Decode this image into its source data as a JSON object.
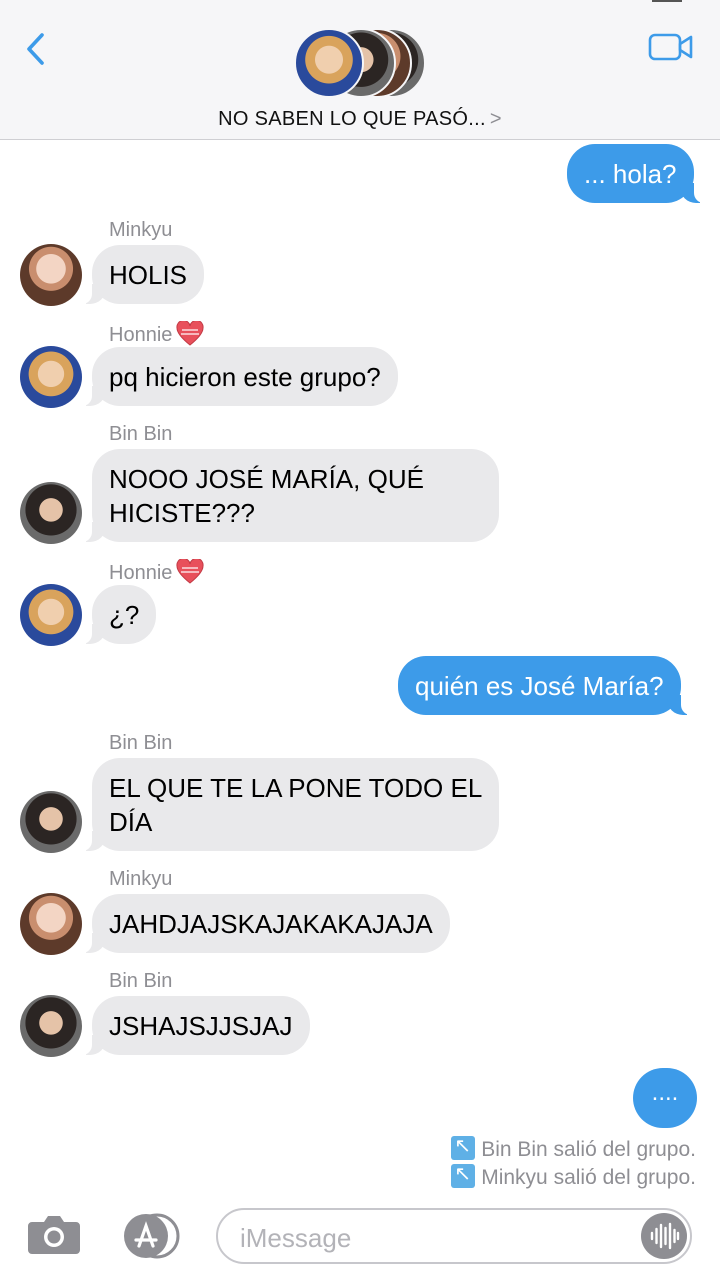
{
  "header": {
    "group_name": "NO SABEN LO QUE PASÓ...",
    "chevron": ">",
    "back_icon": "chevron-left-icon",
    "video_icon": "video-camera-icon",
    "accent": "#3d9be9"
  },
  "messages": {
    "m1": {
      "text": "... hola?"
    },
    "m2": {
      "sender": "Minkyu",
      "text": "HOLIS"
    },
    "m3": {
      "sender": "Honnie",
      "text": "pq hicieron este grupo?"
    },
    "m4": {
      "sender": "Bin Bin",
      "text": "NOOO JOSÉ MARÍA, QUÉ HICISTE???"
    },
    "m5": {
      "sender": "Honnie",
      "text": "¿?"
    },
    "m6": {
      "text": "quién es José María?"
    },
    "m7": {
      "sender": "Bin Bin",
      "text": "EL QUE TE LA PONE TODO EL DÍA"
    },
    "m8": {
      "sender": "Minkyu",
      "text": "JAHDJAJSKAJAKAKAJAJA"
    },
    "m9": {
      "sender": "Bin Bin",
      "text": "JSHAJSJJSJAJ"
    }
  },
  "typing": {
    "text": "...."
  },
  "system": {
    "left1": "Bin Bin salió del grupo.",
    "left2": "Minkyu salió del grupo."
  },
  "input": {
    "placeholder": "iMessage",
    "camera_icon": "camera-icon",
    "appstore_icon": "app-store-icon",
    "audio_icon": "audio-waveform-icon"
  },
  "colors": {
    "outgoing_bubble": "#3d9be9",
    "incoming_bubble": "#e9e9eb",
    "sender_label": "#8e8e93"
  }
}
